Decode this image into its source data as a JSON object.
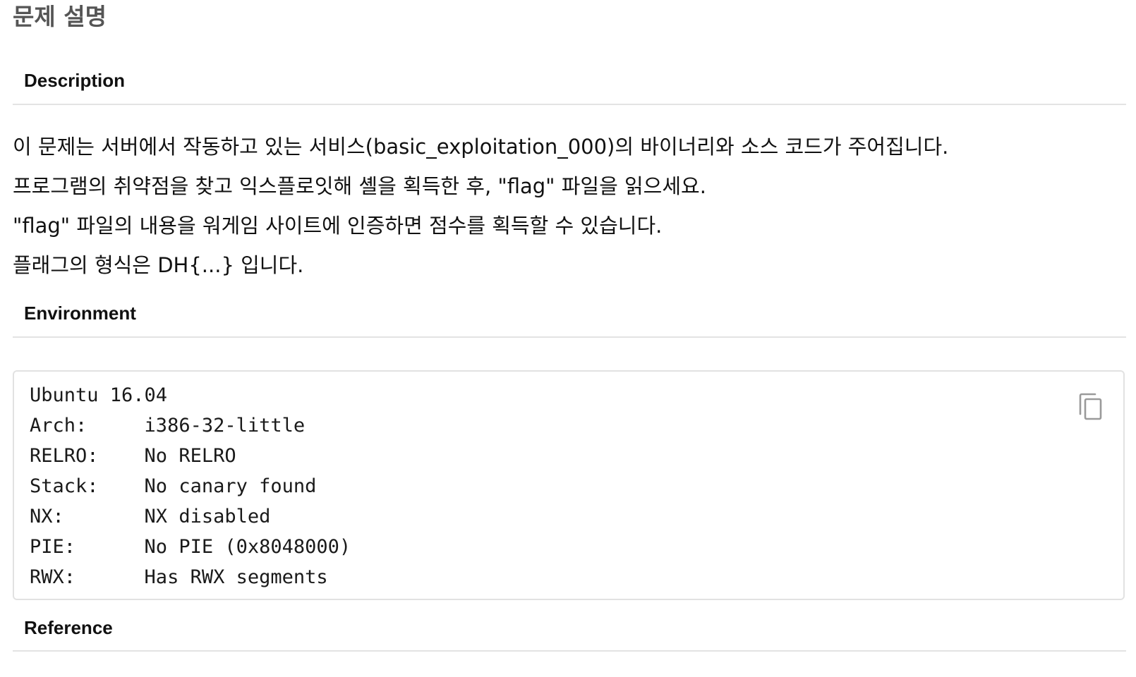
{
  "page_title": "문제 설명",
  "sections": {
    "description": {
      "heading": "Description",
      "lines": [
        "이 문제는 서버에서 작동하고 있는 서비스(basic_exploitation_000)의 바이너리와 소스 코드가 주어집니다.",
        "프로그램의 취약점을 찾고 익스플로잇해 셸을 획득한 후, \"flag\" 파일을 읽으세요.",
        "\"flag\" 파일의 내용을 워게임 사이트에 인증하면 점수를 획득할 수 있습니다.",
        "플래그의 형식은 DH{...} 입니다."
      ]
    },
    "environment": {
      "heading": "Environment",
      "code": "Ubuntu 16.04\nArch:     i386-32-little\nRELRO:    No RELRO\nStack:    No canary found\nNX:       NX disabled\nPIE:      No PIE (0x8048000)\nRWX:      Has RWX segments",
      "copy_icon": "copy-icon"
    },
    "reference": {
      "heading": "Reference"
    }
  },
  "colors": {
    "title": "#555555",
    "rule": "#e3e3e3",
    "code_border": "#e2e2e2",
    "icon": "#9a9a9a"
  }
}
